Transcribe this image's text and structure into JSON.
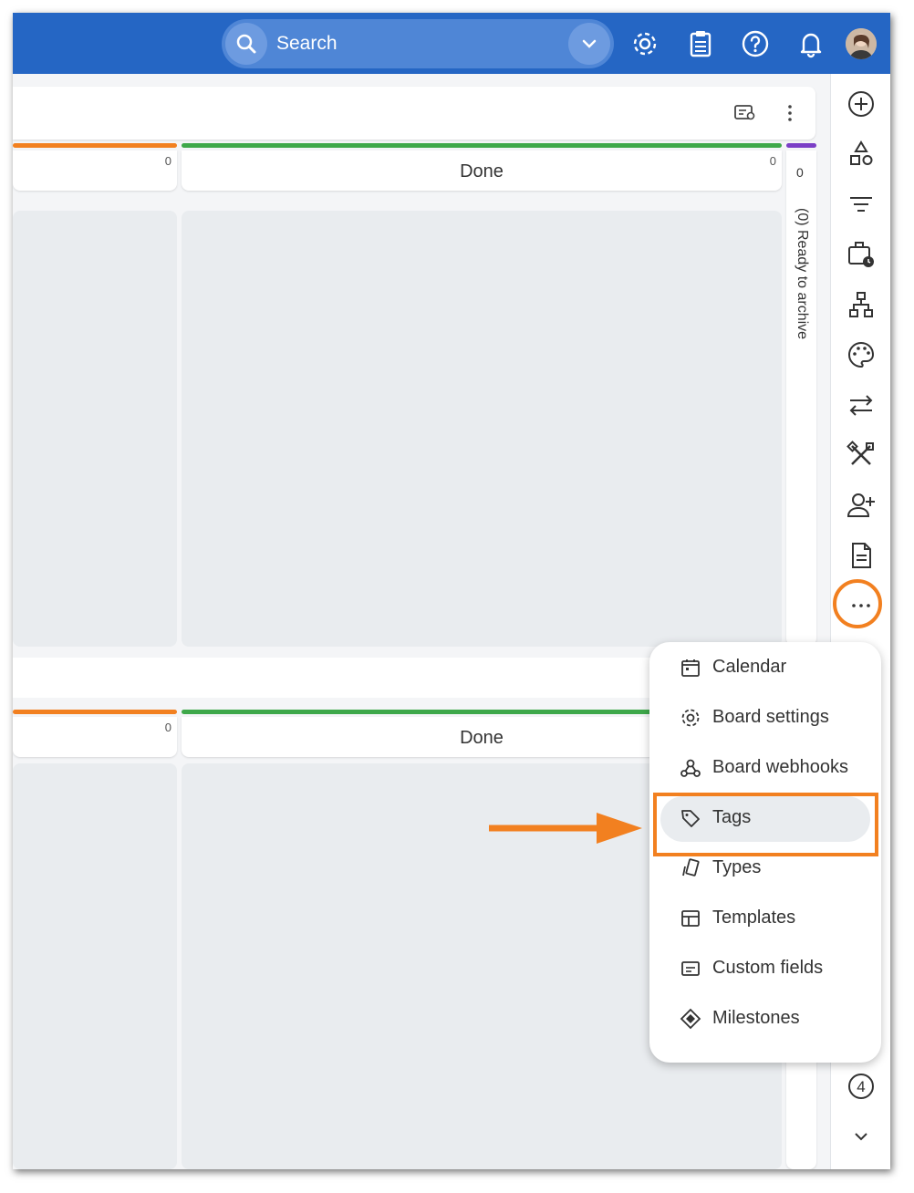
{
  "topbar": {
    "search_placeholder": "Search",
    "icons": [
      "search-icon",
      "chevron-down-icon",
      "gear-icon",
      "clipboard-icon",
      "help-icon",
      "bell-icon",
      "avatar"
    ]
  },
  "board": {
    "lane1": {
      "left_count": "0",
      "done_title": "Done",
      "done_count": "0",
      "narrow_count": "0",
      "archive_label": "(0) Ready to archive"
    },
    "lane2": {
      "left_count": "0",
      "done_title": "Done"
    }
  },
  "rail": {
    "icons": [
      "plus-circle-icon",
      "shapes-icon",
      "filter-icon",
      "briefcase-clock-icon",
      "hierarchy-icon",
      "palette-icon",
      "swap-arrows-icon",
      "tools-icon",
      "add-user-icon",
      "document-icon",
      "more-icon",
      "number-4-icon",
      "chevron-down-icon"
    ],
    "number_badge": "4"
  },
  "menu": {
    "items": [
      {
        "label": "Calendar",
        "icon": "calendar-icon"
      },
      {
        "label": "Board settings",
        "icon": "gear-icon"
      },
      {
        "label": "Board webhooks",
        "icon": "webhook-icon"
      },
      {
        "label": "Tags",
        "icon": "tag-icon"
      },
      {
        "label": "Types",
        "icon": "types-icon"
      },
      {
        "label": "Templates",
        "icon": "template-icon"
      },
      {
        "label": "Custom fields",
        "icon": "custom-fields-icon"
      },
      {
        "label": "Milestones",
        "icon": "milestone-icon"
      }
    ]
  },
  "colors": {
    "topbar": "#2566c4",
    "accent_orange": "#f28020",
    "lane_green": "#3ea84a",
    "lane_orange": "#f28020",
    "lane_purple": "#7b3fc6"
  }
}
